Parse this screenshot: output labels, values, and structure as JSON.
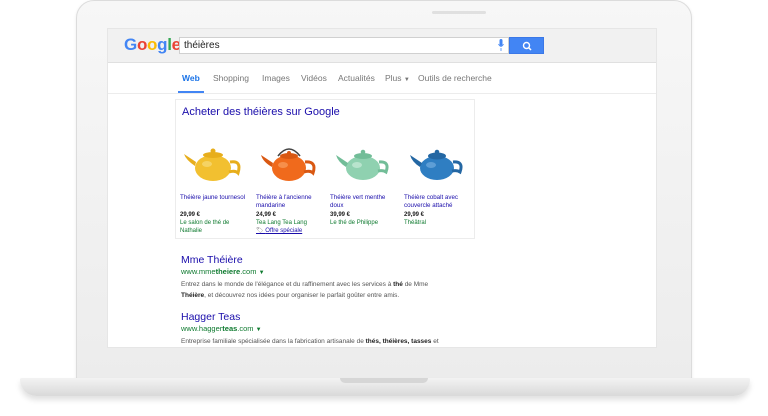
{
  "header": {
    "logo_text": "Google",
    "search_value": "théières"
  },
  "tabs": [
    "Web",
    "Shopping",
    "Images",
    "Vidéos",
    "Actualités",
    "Plus",
    "Outils de recherche"
  ],
  "shopping": {
    "title": "Acheter des théières sur Google",
    "products": [
      {
        "name": "Théière jaune tournesol",
        "price": "29,99 €",
        "store": "Le salon de thé de Nathalie",
        "color": "#f2c030"
      },
      {
        "name": "Théière à l'ancienne mandarine",
        "price": "24,99 €",
        "store": "Tea Lang Tea Lang",
        "offer": "Offre spéciale",
        "color": "#f06a1c"
      },
      {
        "name": "Théière vert menthe doux",
        "price": "39,99 €",
        "store": "Le thé de Philippe",
        "color": "#8fd1b0"
      },
      {
        "name": "Théière cobalt avec couvercle attaché",
        "price": "29,99 €",
        "store": "Théâtral",
        "color": "#2f7ec2"
      }
    ]
  },
  "results": [
    {
      "title": "Mme Théière",
      "url_prefix": "www.mme",
      "url_bold": "theiere",
      "url_suffix": ".com",
      "snippet_1": "Entrez dans le monde de l'élégance et du raffinement avec les services à ",
      "snippet_b1": "thé",
      "snippet_2": " de Mme ",
      "snippet_b2": "Théière",
      "snippet_3": ", et découvrez nos idées pour organiser le parfait goûter entre amis."
    },
    {
      "title": "Hagger Teas",
      "url_prefix": "www.hagger",
      "url_bold": "teas",
      "url_suffix": ".com",
      "snippet_1": "Entreprise familiale spécialisée dans la fabrication artisanale de ",
      "snippet_b1": "thés, théières, tasses",
      "snippet_2": " et"
    }
  ],
  "colors": {
    "link": "#1a0dab",
    "url_green": "#0e7a2f",
    "accent_blue": "#4285f4"
  }
}
